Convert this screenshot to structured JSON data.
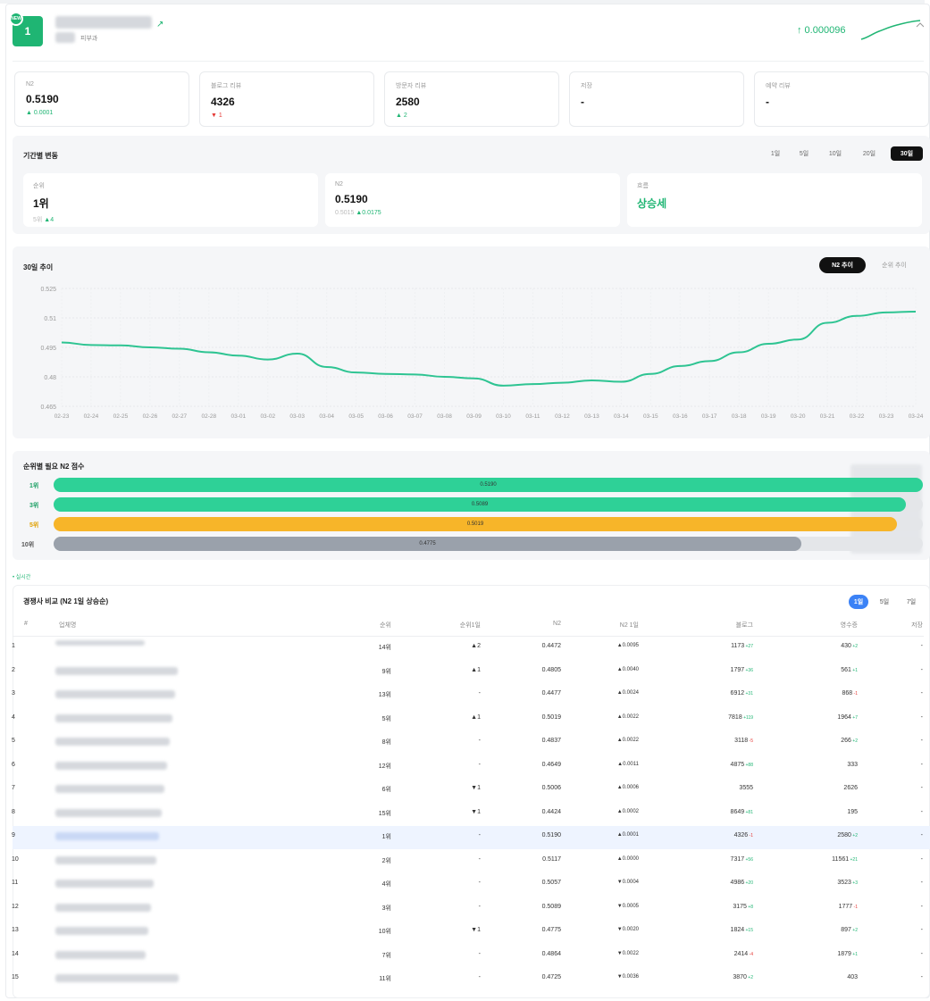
{
  "header": {
    "rank": "1",
    "new_badge": "NEW",
    "category": "피부과",
    "value": "↑ 0.000096",
    "collapse_icon": "chevron-up-icon",
    "external_icon": "external-link-icon"
  },
  "kpis": [
    {
      "label": "N2",
      "value": "0.5190",
      "change": "▲ 0.0001",
      "dir": "up"
    },
    {
      "label": "블로그 리뷰",
      "value": "4326",
      "change": "▼ 1",
      "dir": "down"
    },
    {
      "label": "방문자 리뷰",
      "value": "2580",
      "change": "▲ 2",
      "dir": "up"
    },
    {
      "label": "저장",
      "value": "-",
      "change": "",
      "dir": "none"
    },
    {
      "label": "예약 리뷰",
      "value": "-",
      "change": "",
      "dir": "none"
    }
  ],
  "period": {
    "title": "기간별 변동",
    "options": [
      "1일",
      "5일",
      "10일",
      "20일",
      "30일"
    ],
    "active": "30일",
    "cards": [
      {
        "label": "순위",
        "value": "1위",
        "sub_prefix": "5위",
        "sub_change": "▲4",
        "color": "#111"
      },
      {
        "label": "N2",
        "value": "0.5190",
        "sub_prefix": "0.5015",
        "sub_change": "▲0.0175",
        "color": "#111"
      },
      {
        "label": "흐름",
        "value": "상승세",
        "sub_prefix": "",
        "sub_change": "",
        "color": "#1fb573"
      }
    ]
  },
  "trend": {
    "title": "30일 추이",
    "tabs": [
      "N2 추이",
      "순위 추이"
    ],
    "active_tab": "N2 추이"
  },
  "chart_data": {
    "type": "line",
    "title": "30일 추이",
    "x": [
      "02-23",
      "02-24",
      "02-25",
      "02-26",
      "02-27",
      "02-28",
      "03-01",
      "03-02",
      "03-03",
      "03-04",
      "03-05",
      "03-06",
      "03-07",
      "03-08",
      "03-09",
      "03-10",
      "03-11",
      "03-12",
      "03-13",
      "03-14",
      "03-15",
      "03-16",
      "03-17",
      "03-18",
      "03-19",
      "03-20",
      "03-21",
      "03-22",
      "03-23",
      "03-24"
    ],
    "series": [
      {
        "values": [
          0.4975,
          0.4962,
          0.496,
          0.495,
          0.4943,
          0.4925,
          0.4908,
          0.4888,
          0.4918,
          0.485,
          0.4822,
          0.4815,
          0.4812,
          0.48,
          0.4792,
          0.4755,
          0.4763,
          0.477,
          0.4782,
          0.4775,
          0.4815,
          0.4855,
          0.488,
          0.4925,
          0.4968,
          0.499,
          0.5075,
          0.511,
          0.5128,
          0.5132
        ],
        "color": "#2ec492"
      }
    ],
    "yticks": [
      "0.525",
      "0.51",
      "0.495",
      "0.48",
      "0.465"
    ],
    "ylim": [
      0.465,
      0.525
    ],
    "grid": true
  },
  "required": {
    "title": "순위별 필요 N2 점수",
    "bars": [
      {
        "label": "1위",
        "value": "0.5190",
        "score": 0.519,
        "fill": 1.0,
        "color": "#2ed197",
        "label_color": "#1a9f63"
      },
      {
        "label": "3위",
        "value": "0.5089",
        "score": 0.5089,
        "fill": 0.98,
        "color": "#2ed197",
        "label_color": "#1a9f63"
      },
      {
        "label": "5위",
        "value": "0.5019",
        "score": 0.5019,
        "fill": 0.97,
        "color": "#f7b529",
        "label_color": "#e0a000"
      },
      {
        "label": "10위",
        "value": "0.4775",
        "score": 0.4775,
        "fill": 0.86,
        "color": "#9aa1ab",
        "label_color": "#555"
      }
    ]
  },
  "realtime_link": "• 실시간",
  "competitors": {
    "title": "경쟁사 비교 (N2 1일 상승순)",
    "tabs": [
      "1일",
      "5일",
      "7일"
    ],
    "active_tab": "1일",
    "columns": [
      "#",
      "업체명",
      "순위",
      "순위1일",
      "N2",
      "N2 1일",
      "블로그",
      "영수증",
      "저장"
    ],
    "rows": [
      {
        "n": "1",
        "rank": "14위",
        "rank1": "▲2",
        "rank1dir": "up",
        "n2": "0.4472",
        "n21": "▲0.0095",
        "n21dir": "up",
        "blog": "1173",
        "blogd": "+27",
        "blogdir": "up",
        "rcpt": "430",
        "rcptd": "+2",
        "rcptdir": "up",
        "save": "-"
      },
      {
        "n": "2",
        "rank": "9위",
        "rank1": "▲1",
        "rank1dir": "up",
        "n2": "0.4805",
        "n21": "▲0.0040",
        "n21dir": "up",
        "blog": "1797",
        "blogd": "+36",
        "blogdir": "up",
        "rcpt": "561",
        "rcptd": "+1",
        "rcptdir": "up",
        "save": "-"
      },
      {
        "n": "3",
        "rank": "13위",
        "rank1": "-",
        "rank1dir": "none",
        "n2": "0.4477",
        "n21": "▲0.0024",
        "n21dir": "up",
        "blog": "6912",
        "blogd": "+31",
        "blogdir": "up",
        "rcpt": "868",
        "rcptd": "-1",
        "rcptdir": "down",
        "save": "-"
      },
      {
        "n": "4",
        "rank": "5위",
        "rank1": "▲1",
        "rank1dir": "up",
        "n2": "0.5019",
        "n21": "▲0.0022",
        "n21dir": "up",
        "blog": "7818",
        "blogd": "+119",
        "blogdir": "up",
        "rcpt": "1964",
        "rcptd": "+7",
        "rcptdir": "up",
        "save": "-"
      },
      {
        "n": "5",
        "rank": "8위",
        "rank1": "-",
        "rank1dir": "none",
        "n2": "0.4837",
        "n21": "▲0.0022",
        "n21dir": "up",
        "blog": "3118",
        "blogd": "-5",
        "blogdir": "down",
        "rcpt": "266",
        "rcptd": "+2",
        "rcptdir": "up",
        "save": "-"
      },
      {
        "n": "6",
        "rank": "12위",
        "rank1": "-",
        "rank1dir": "none",
        "n2": "0.4649",
        "n21": "▲0.0011",
        "n21dir": "up",
        "blog": "4875",
        "blogd": "+88",
        "blogdir": "up",
        "rcpt": "333",
        "rcptd": "",
        "rcptdir": "none",
        "save": "-"
      },
      {
        "n": "7",
        "rank": "6위",
        "rank1": "▼1",
        "rank1dir": "down",
        "n2": "0.5006",
        "n21": "▲0.0006",
        "n21dir": "up",
        "blog": "3555",
        "blogd": "",
        "blogdir": "none",
        "rcpt": "2626",
        "rcptd": "",
        "rcptdir": "none",
        "save": "-"
      },
      {
        "n": "8",
        "rank": "15위",
        "rank1": "▼1",
        "rank1dir": "down",
        "n2": "0.4424",
        "n21": "▲0.0002",
        "n21dir": "up",
        "blog": "8649",
        "blogd": "+81",
        "blogdir": "up",
        "rcpt": "195",
        "rcptd": "",
        "rcptdir": "none",
        "save": "-"
      },
      {
        "n": "9",
        "rank": "1위",
        "rank1": "-",
        "rank1dir": "none",
        "n2": "0.5190",
        "n21": "▲0.0001",
        "n21dir": "up",
        "blog": "4326",
        "blogd": "-1",
        "blogdir": "down",
        "rcpt": "2580",
        "rcptd": "+2",
        "rcptdir": "up",
        "save": "-",
        "highlight": true
      },
      {
        "n": "10",
        "rank": "2위",
        "rank1": "-",
        "rank1dir": "none",
        "n2": "0.5117",
        "n21": "▲0.0000",
        "n21dir": "up",
        "blog": "7317",
        "blogd": "+56",
        "blogdir": "up",
        "rcpt": "11561",
        "rcptd": "+21",
        "rcptdir": "up",
        "save": "-"
      },
      {
        "n": "11",
        "rank": "4위",
        "rank1": "-",
        "rank1dir": "none",
        "n2": "0.5057",
        "n21": "▼0.0004",
        "n21dir": "down",
        "blog": "4986",
        "blogd": "+20",
        "blogdir": "up",
        "rcpt": "3523",
        "rcptd": "+3",
        "rcptdir": "up",
        "save": "-"
      },
      {
        "n": "12",
        "rank": "3위",
        "rank1": "-",
        "rank1dir": "none",
        "n2": "0.5089",
        "n21": "▼0.0005",
        "n21dir": "down",
        "blog": "3175",
        "blogd": "+8",
        "blogdir": "up",
        "rcpt": "1777",
        "rcptd": "-1",
        "rcptdir": "down",
        "save": "-"
      },
      {
        "n": "13",
        "rank": "10위",
        "rank1": "▼1",
        "rank1dir": "down",
        "n2": "0.4775",
        "n21": "▼0.0020",
        "n21dir": "down",
        "blog": "1824",
        "blogd": "+15",
        "blogdir": "up",
        "rcpt": "897",
        "rcptd": "+2",
        "rcptdir": "up",
        "save": "-"
      },
      {
        "n": "14",
        "rank": "7위",
        "rank1": "-",
        "rank1dir": "none",
        "n2": "0.4864",
        "n21": "▼0.0022",
        "n21dir": "down",
        "blog": "2414",
        "blogd": "-4",
        "blogdir": "down",
        "rcpt": "1879",
        "rcptd": "+1",
        "rcptdir": "up",
        "save": "-"
      },
      {
        "n": "15",
        "rank": "11위",
        "rank1": "-",
        "rank1dir": "none",
        "n2": "0.4725",
        "n21": "▼0.0036",
        "n21dir": "down",
        "blog": "3870",
        "blogd": "+2",
        "blogdir": "up",
        "rcpt": "403",
        "rcptd": "",
        "rcptdir": "none",
        "save": "-"
      }
    ]
  }
}
